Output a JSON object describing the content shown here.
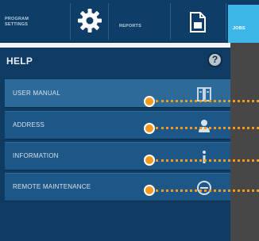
{
  "topbar": {
    "program_settings": "PROGRAM SETTINGS",
    "reports": "REPORTS",
    "jobs": "JOBS"
  },
  "help": {
    "title": "HELP",
    "icon_glyph": "?",
    "items": [
      {
        "label": "USER MANUAL",
        "icon": "book-icon"
      },
      {
        "label": "ADDRESS",
        "icon": "person-icon"
      },
      {
        "label": "INFORMATION",
        "icon": "info-icon"
      },
      {
        "label": "REMOTE MAINTENANCE",
        "icon": "remote-icon"
      }
    ]
  },
  "colors": {
    "panel": "#0f3a61",
    "row": "#1d5787",
    "accent": "#f39a1e",
    "jobs_tab": "#3fb6e8"
  }
}
